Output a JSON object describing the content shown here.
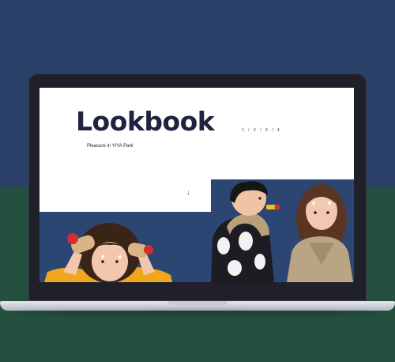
{
  "page": {
    "title": "Lookbook",
    "pager": "1 / 2 / 3 / 4",
    "subtitle": "Pleasure in YIYA Park",
    "scroll_arrow": "↓"
  },
  "icons": {
    "scroll": "arrow-down-icon"
  },
  "colors": {
    "background_top": "#2a4068",
    "background_bottom": "#245040",
    "photo_background": "#2b4672",
    "title": "#1f2340"
  }
}
